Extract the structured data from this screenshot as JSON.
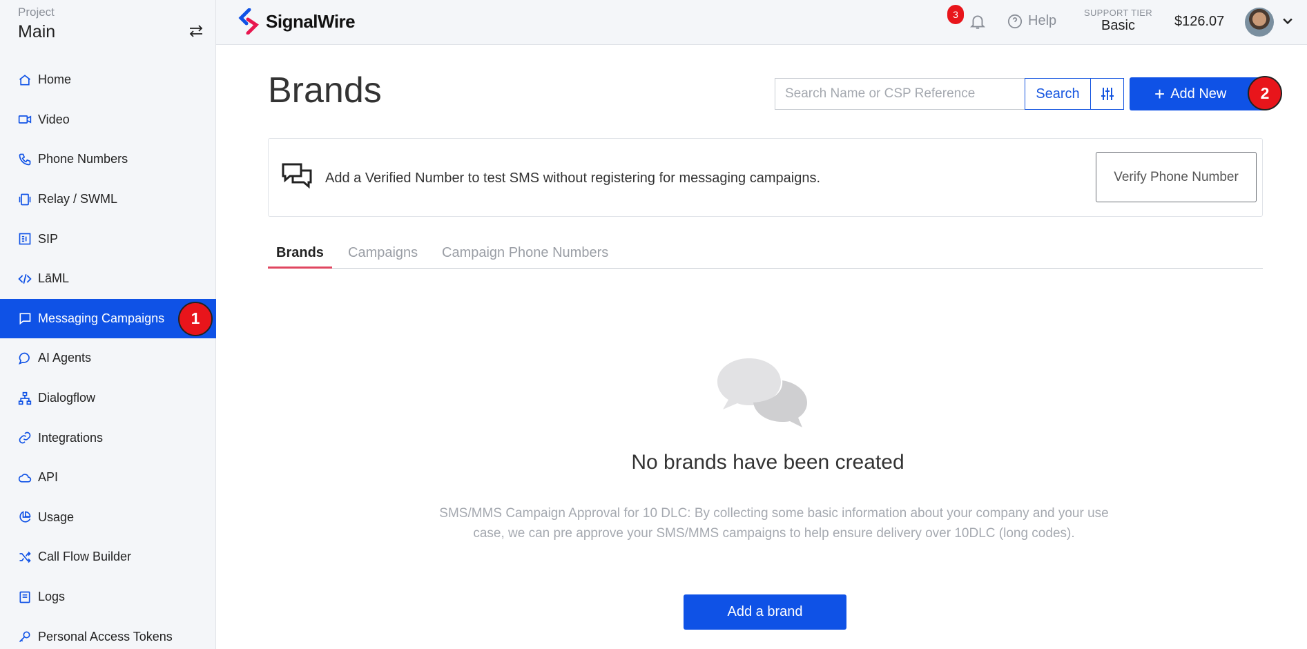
{
  "project": {
    "label": "Project",
    "name": "Main"
  },
  "sidebar": {
    "items": [
      {
        "label": "Home",
        "icon": "home-icon"
      },
      {
        "label": "Video",
        "icon": "video-icon"
      },
      {
        "label": "Phone Numbers",
        "icon": "phone-icon"
      },
      {
        "label": "Relay / SWML",
        "icon": "relay-icon"
      },
      {
        "label": "SIP",
        "icon": "sip-icon"
      },
      {
        "label": "LāML",
        "icon": "code-icon"
      },
      {
        "label": "Messaging Campaigns",
        "icon": "message-icon",
        "active": true,
        "badge": "1"
      },
      {
        "label": "AI Agents",
        "icon": "chat-icon"
      },
      {
        "label": "Dialogflow",
        "icon": "network-icon"
      },
      {
        "label": "Integrations",
        "icon": "link-icon"
      },
      {
        "label": "API",
        "icon": "cloud-icon"
      },
      {
        "label": "Usage",
        "icon": "pie-chart-icon"
      },
      {
        "label": "Call Flow Builder",
        "icon": "shuffle-icon"
      },
      {
        "label": "Logs",
        "icon": "log-icon"
      },
      {
        "label": "Personal Access Tokens",
        "icon": "key-icon"
      }
    ]
  },
  "header": {
    "brand": "SignalWire",
    "notification_count": "3",
    "help_label": "Help",
    "support_tier_label": "SUPPORT TIER",
    "support_tier_value": "Basic",
    "balance": "$126.07"
  },
  "main": {
    "title": "Brands",
    "search_placeholder": "Search Name or CSP Reference",
    "search_button": "Search",
    "add_new_label": "Add New",
    "add_new_badge": "2",
    "verify_text": "Add a Verified Number to test SMS without registering for messaging campaigns.",
    "verify_button": "Verify Phone Number",
    "tabs": [
      {
        "label": "Brands",
        "active": true
      },
      {
        "label": "Campaigns"
      },
      {
        "label": "Campaign Phone Numbers"
      }
    ],
    "empty_title": "No brands have been created",
    "empty_description": "SMS/MMS Campaign Approval for 10 DLC: By collecting some basic information about your company and your use case, we can pre approve your SMS/MMS campaigns to help ensure delivery over 10DLC (long codes).",
    "add_brand_button": "Add a brand"
  },
  "colors": {
    "accent": "#0f52e6",
    "badge": "#e8151b",
    "tab_underline": "#e04660"
  }
}
